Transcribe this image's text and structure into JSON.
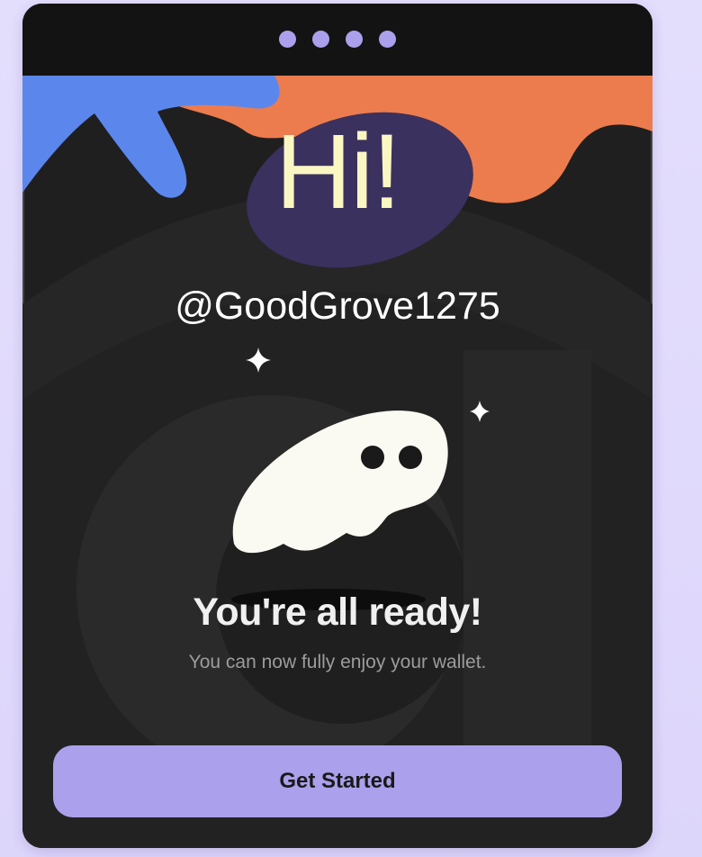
{
  "colors": {
    "page_background": "#e2dcfc",
    "card_background": "#1f1f1f",
    "header_background": "#131313",
    "accent_purple": "#aba0ec",
    "blob_orange": "#ec7c4e",
    "star_blue": "#5b87ec",
    "bubble_navy": "#3b315e",
    "greeting_yellow": "#fbf7c3",
    "ghost_white": "#fbfaf2"
  },
  "pagination": {
    "dot_count": 4
  },
  "greeting": {
    "text": "Hi!"
  },
  "user": {
    "handle": "@GoodGrove1275"
  },
  "status": {
    "headline": "You're all ready!",
    "description": "You can now fully enjoy your wallet."
  },
  "actions": {
    "primary_label": "Get Started"
  },
  "icons": {
    "sparkle": "sparkle-icon",
    "mascot": "ghost-mascot-icon"
  }
}
